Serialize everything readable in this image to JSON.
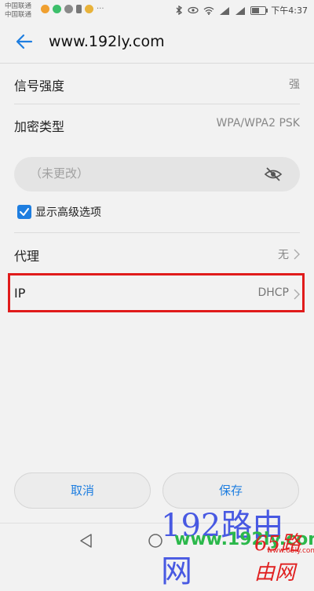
{
  "status_bar": {
    "carrier_1": "中国联通",
    "carrier_2": "中国联通",
    "time": "下午4:37",
    "battery_level": 0.55
  },
  "header": {
    "title": "www.192ly.com",
    "back_icon": "arrow-left-icon"
  },
  "rows": {
    "signal": {
      "label": "信号强度",
      "value": "强"
    },
    "encryption": {
      "label": "加密类型",
      "value": "WPA/WPA2 PSK"
    },
    "proxy": {
      "label": "代理",
      "value": "无"
    },
    "ip": {
      "label": "IP",
      "value": "DHCP"
    }
  },
  "password": {
    "placeholder": "（未更改）",
    "toggle_icon": "eye-off-icon"
  },
  "advanced": {
    "label": "显示高级选项",
    "checked": true
  },
  "buttons": {
    "cancel": "取消",
    "save": "保存"
  },
  "watermark": {
    "text_1": "192路由网",
    "text_2": "www.192ly.com",
    "text_3": "65路由网",
    "text_4": "www.65ly.com"
  },
  "colors": {
    "accent": "#1e7ee0",
    "highlight": "#e01b1b"
  }
}
